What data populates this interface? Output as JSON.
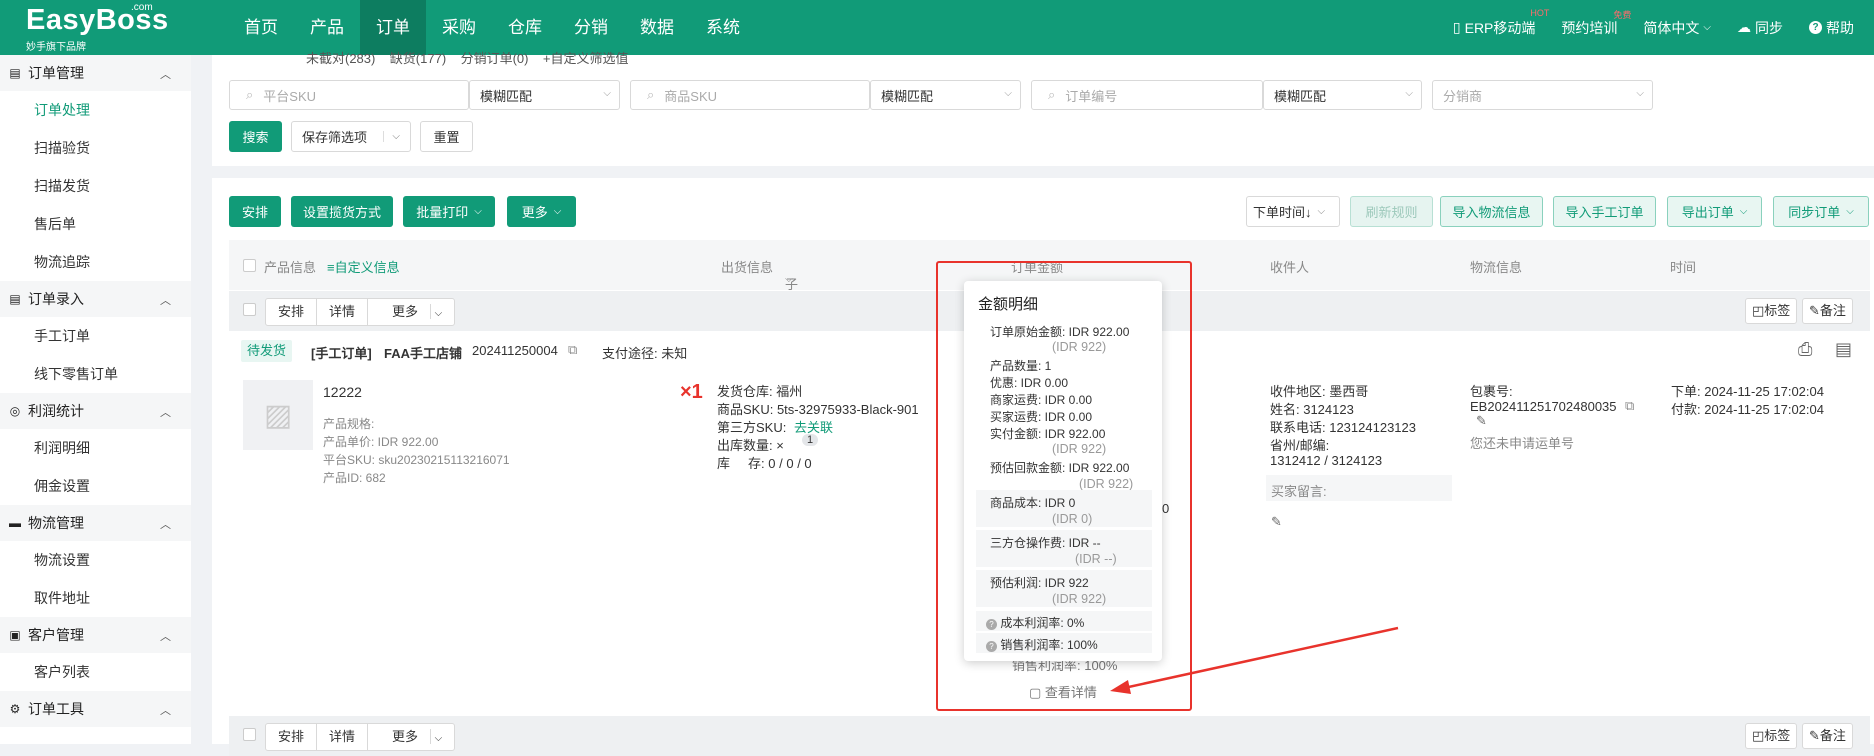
{
  "brand": {
    "name": "EasyBoss",
    "com": ".com",
    "sub": "妙手旗下品牌"
  },
  "topnav": [
    "首页",
    "产品",
    "订单",
    "采购",
    "仓库",
    "分销",
    "数据",
    "系统"
  ],
  "topright": {
    "erp": "ERP移动端",
    "erp_badge": "HOT",
    "training": "预约培训",
    "training_badge": "免费",
    "lang": "简体中文",
    "sync": "同步",
    "help": "帮助"
  },
  "sidebar": [
    {
      "group": "订单管理",
      "icon": "doc-icon",
      "items": [
        "订单处理",
        "扫描验货",
        "扫描发货",
        "售后单",
        "物流追踪"
      ]
    },
    {
      "group": "订单录入",
      "icon": "list-icon",
      "items": [
        "手工订单",
        "线下零售订单"
      ]
    },
    {
      "group": "利润统计",
      "icon": "money-icon",
      "items": [
        "利润明细",
        "佣金设置"
      ]
    },
    {
      "group": "物流管理",
      "icon": "truck-icon",
      "items": [
        "物流设置",
        "取件地址"
      ]
    },
    {
      "group": "客户管理",
      "icon": "user-icon",
      "items": [
        "客户列表"
      ]
    },
    {
      "group": "订单工具",
      "icon": "tool-icon",
      "items": []
    }
  ],
  "filters": {
    "top_partial": "未截对(283)    缺货(177)    分销订单(0)    +自定义筛选值",
    "platform_sku": "平台SKU",
    "match1": "模糊匹配",
    "product_sku": "商品SKU",
    "match2": "模糊匹配",
    "order_no": "订单编号",
    "match3": "模糊匹配",
    "distributor": "分销商",
    "search": "搜索",
    "save_filter": "保存筛选项",
    "reset": "重置"
  },
  "toolbar": {
    "arrange": "安排",
    "set_pickup": "设置揽货方式",
    "batch_print": "批量打印",
    "more": "更多",
    "order_time": "下单时间↓",
    "refresh_rule": "刷新规则",
    "import_logistics": "导入物流信息",
    "import_manual": "导入手工订单",
    "export_orders": "导出订单",
    "sync_orders": "同步订单"
  },
  "table_header": {
    "product": "产品信息",
    "custom": "≡自定义信息",
    "shipping": "出货信息",
    "sub_product": "子商品",
    "amount": "订单金额",
    "receiver": "收件人",
    "logistics": "物流信息",
    "time": "时间"
  },
  "group_actions": {
    "arrange": "安排",
    "detail": "详情",
    "more": "更多",
    "label": "标签",
    "note": "备注"
  },
  "order": {
    "status": "待发货",
    "type": "[手工订单]",
    "shop": "FAA手工店铺",
    "order_no": "202411250004",
    "pay_way": "支付途径: 未知",
    "product_name": "12222",
    "spec": "产品规格:",
    "unit_price": "产品单价: IDR 922.00",
    "platform_sku": "平台SKU: sku20230215113216071",
    "product_id": "产品ID: 682",
    "qty": "×1",
    "warehouse": "发货仓库: 福州",
    "sku": "商品SKU: 5ts-32975933-Black-901",
    "third_sku_label": "第三方SKU:",
    "third_sku_link": "去关联",
    "out_qty": "出库数量: ×",
    "out_qty_badge": "1",
    "stock": "库     存: 0 / 0 / 0",
    "region": "收件地区: 墨西哥",
    "name": "姓名: 3124123",
    "phone": "联系电话: 123124123123",
    "province_label": "省州/邮编:",
    "province": "1312412 / 3124123",
    "buyer_msg": "买家留言:",
    "package_label": "包裹号:",
    "package": "EB202411251702480035",
    "no_tracking": "您还未申请运单号",
    "order_time": "下单: 2024-11-25 17:02:04",
    "pay_time": "付款: 2024-11-25 17:02:04",
    "view_detail": "查看详情",
    "partial_under": "销售利润率: 100%",
    "partial_right": "0"
  },
  "popup": {
    "title": "金额明细",
    "orig_amount": "订单原始金额: IDR 922.00",
    "orig_amount_sub": "(IDR 922)",
    "product_qty": "产品数量: 1",
    "discount": "优惠: IDR 0.00",
    "seller_freight": "商家运费: IDR 0.00",
    "buyer_freight": "买家运费: IDR 0.00",
    "paid": "实付金额: IDR 922.00",
    "paid_sub": "(IDR 922)",
    "est_receipt": "预估回款金额: IDR 922.00",
    "est_receipt_sub": "(IDR 922)",
    "cost": "商品成本: IDR 0",
    "cost_sub": "(IDR 0)",
    "wh_fee": "三方仓操作费: IDR --",
    "wh_fee_sub": "(IDR --)",
    "est_profit": "预估利润: IDR 922",
    "est_profit_sub": "(IDR 922)",
    "cost_margin": "成本利润率: 0%",
    "sales_margin": "销售利润率: 100%"
  },
  "colors": {
    "brand": "#119b78",
    "highlight": "#e8332c"
  }
}
